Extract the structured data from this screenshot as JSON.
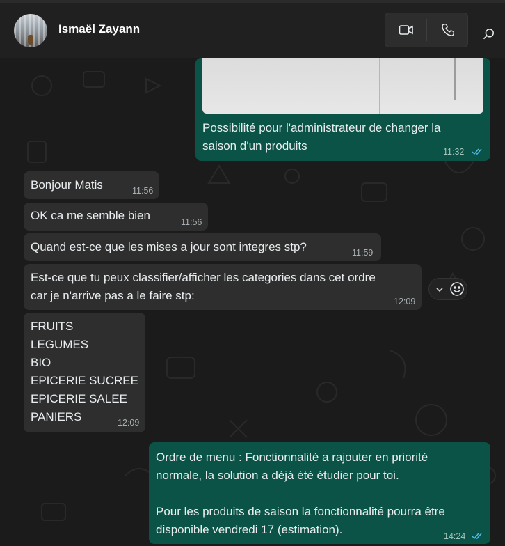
{
  "header": {
    "contact_name": "Ismaël Zayann",
    "avatar_icon": "avatar-photo",
    "video_icon": "video-camera-icon",
    "phone_icon": "phone-icon",
    "search_icon": "search-icon"
  },
  "messages": [
    {
      "dir": "out",
      "image": true,
      "text": "Possibilité pour l'administrateur de changer la\nsaison d'un produits",
      "time": "11:32",
      "read": true
    },
    {
      "dir": "in",
      "text": "Bonjour Matis",
      "time": "11:56"
    },
    {
      "dir": "in",
      "text": "OK ca me semble bien",
      "time": "11:56"
    },
    {
      "dir": "in",
      "text": "Quand est-ce que les mises a jour sont integres stp?",
      "time": "11:59"
    },
    {
      "dir": "in",
      "text": "Est-ce que tu peux classifier/afficher les categories dans cet ordre\ncar je n'arrive pas a le faire stp:",
      "time": "12:09"
    },
    {
      "dir": "in",
      "text": "FRUITS\nLEGUMES\nBIO\nEPICERIE SUCREE\nEPICERIE SALEE\nPANIERS",
      "time": "12:09"
    },
    {
      "dir": "out",
      "text": "Ordre de menu : Fonctionnalité a rajouter en priorité\nnormale, la solution a déjà été étudier pour toi.\n\nPour les produits de saison la fonctionnalité pourra être\ndisponible vendredi 17 (estimation).",
      "time": "14:24",
      "read": true
    }
  ],
  "colors": {
    "header_bg": "#202020",
    "chat_bg": "#1b1b1b",
    "incoming_bubble": "#2e2e2e",
    "outgoing_bubble": "#0b5346",
    "read_ticks": "#53bdeb"
  },
  "reaction_bar": {
    "chevron_icon": "chevron-down-icon",
    "emoji_icon": "emoji-smile-icon"
  }
}
